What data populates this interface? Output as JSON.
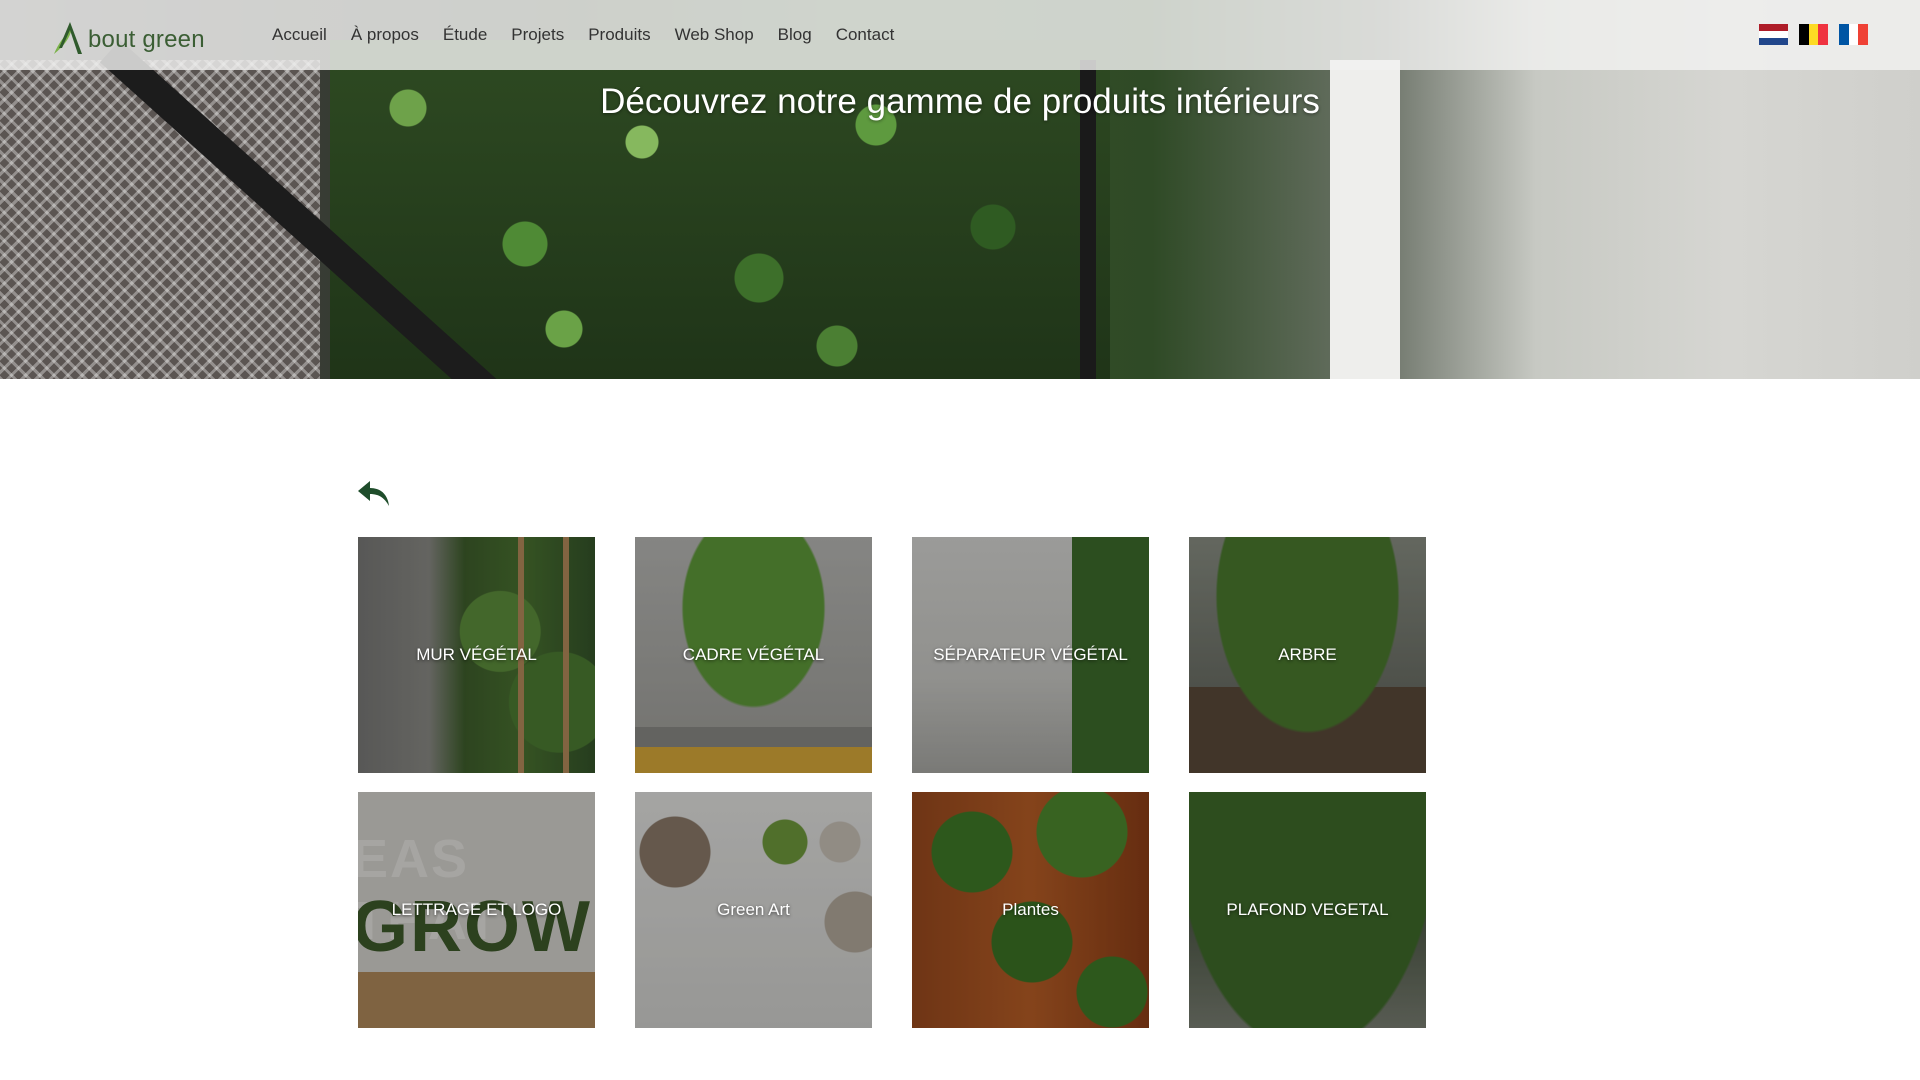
{
  "nav": {
    "logo_text": "bout green",
    "logo_letter": "A",
    "items": [
      {
        "label": "Accueil"
      },
      {
        "label": "À propos"
      },
      {
        "label": "Étude"
      },
      {
        "label": "Projets"
      },
      {
        "label": "Produits"
      },
      {
        "label": "Web Shop"
      },
      {
        "label": "Blog"
      },
      {
        "label": "Contact"
      }
    ],
    "flags": [
      {
        "name": "nl-flag",
        "colors": [
          "#AE1C28",
          "#FFFFFF",
          "#21468B"
        ]
      },
      {
        "name": "be-flag",
        "colors": [
          "#000000",
          "#FDDA24",
          "#EF3340"
        ]
      },
      {
        "name": "fr-flag",
        "colors": [
          "#0055A4",
          "#FFFFFF",
          "#EF4135"
        ]
      }
    ]
  },
  "hero": {
    "title": "Découvrez notre gamme de produits intérieurs"
  },
  "back_icon": "reply-arrow-icon",
  "brand_color": "#1f4d2b",
  "products": [
    {
      "label": "MUR VÉGÉTAL"
    },
    {
      "label": "CADRE VÉGÉTAL"
    },
    {
      "label": "SÉPARATEUR VÉGÉTAL"
    },
    {
      "label": "ARBRE"
    },
    {
      "label": "LETTRAGE ET LOGO"
    },
    {
      "label": "Green Art"
    },
    {
      "label": "Plantes"
    },
    {
      "label": "PLAFOND VEGETAL"
    }
  ],
  "lettrage_image_text": {
    "line1": "EAS THAT",
    "line2": "GROW"
  }
}
